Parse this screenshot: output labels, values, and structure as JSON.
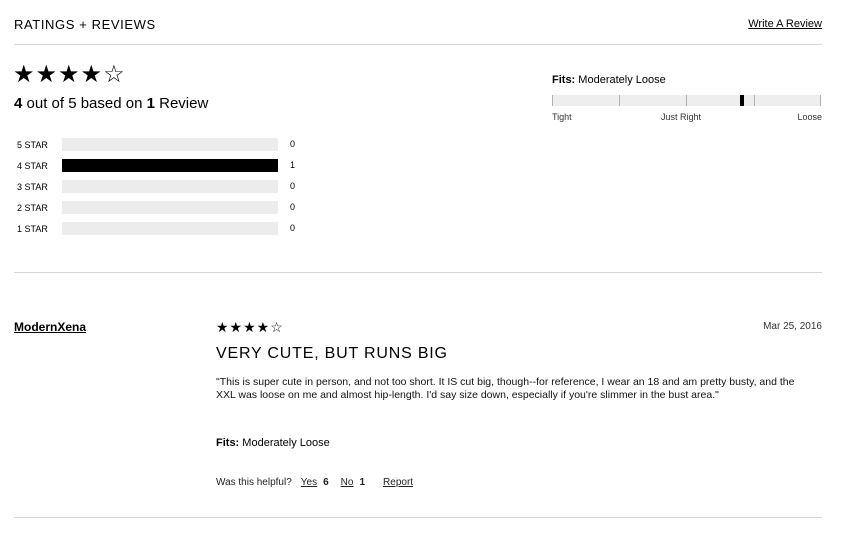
{
  "header": {
    "title": "RATINGS + REVIEWS",
    "write_review": "Write A Review"
  },
  "summary": {
    "stars": "★★★★☆",
    "average": "4",
    "text_mid": " out of 5 based on ",
    "count": "1",
    "text_end": " Review"
  },
  "distribution": [
    {
      "label": "5 STAR",
      "count": "0",
      "fraction": 0
    },
    {
      "label": "4 STAR",
      "count": "1",
      "fraction": 1
    },
    {
      "label": "3 STAR",
      "count": "0",
      "fraction": 0
    },
    {
      "label": "2 STAR",
      "count": "0",
      "fraction": 0
    },
    {
      "label": "1 STAR",
      "count": "0",
      "fraction": 0
    }
  ],
  "fit": {
    "label": "Fits:",
    "value": "Moderately Loose",
    "scale": [
      "Tight",
      "Just Right",
      "Loose"
    ],
    "level": 0.7
  },
  "review": {
    "author": "ModernXena",
    "stars": "★★★★☆",
    "date": "Mar 25, 2016",
    "title": "VERY CUTE, BUT RUNS BIG",
    "body": "\"This is super cute in person, and not too short. It IS cut big, though--for reference, I wear an 18 and am pretty busty, and the XXL was loose on me and almost hip-length. I'd say size down, especially if you're slimmer in the bust area.\"",
    "fits_label": "Fits:",
    "fits_value": "Moderately Loose",
    "helpful_label": "Was this helpful?",
    "yes_label": "Yes",
    "yes_count": "6",
    "no_label": "No",
    "no_count": "1",
    "report_label": "Report"
  }
}
